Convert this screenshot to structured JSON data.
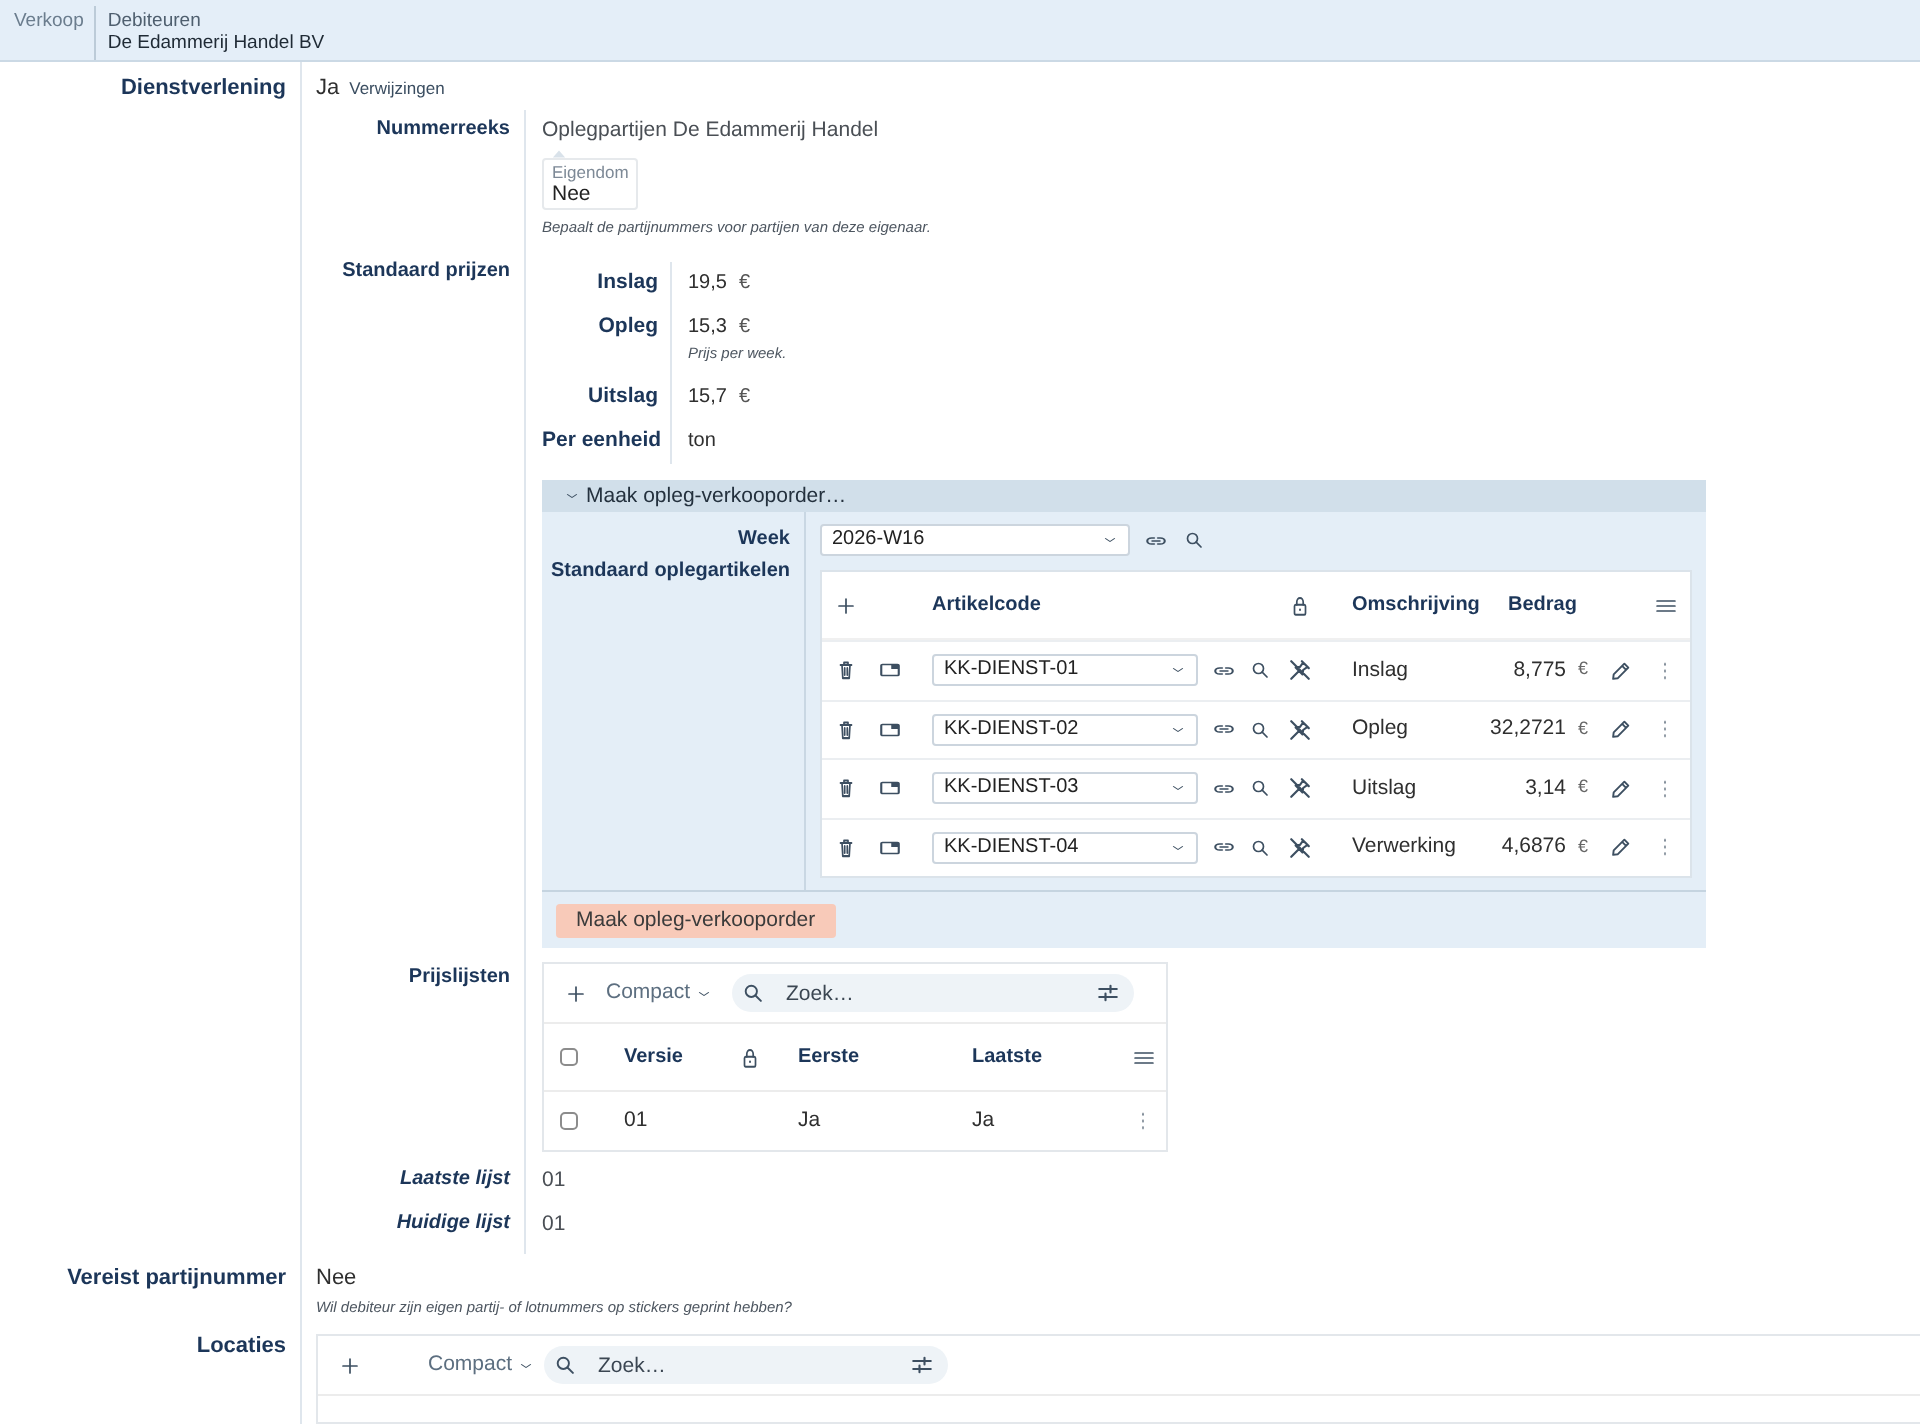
{
  "breadcrumb": {
    "section": "Verkoop",
    "parent": "Debiteuren",
    "current": "De Edammerij Handel BV"
  },
  "dienstverlening": {
    "label": "Dienstverlening",
    "value": "Ja",
    "link": "Verwijzingen",
    "nummerreeks": {
      "label": "Nummerreeks",
      "value": "Oplegpartijen De Edammerij Handel",
      "owner_field": {
        "label": "Eigendom",
        "value": "Nee"
      },
      "hint": "Bepaalt de partijnummers voor partijen van deze eigenaar."
    },
    "standaard_prijzen": {
      "label": "Standaard prijzen",
      "rows": [
        {
          "label": "Inslag",
          "value": "19,5",
          "unit": "€"
        },
        {
          "label": "Opleg",
          "value": "15,3",
          "unit": "€",
          "hint": "Prijs per week."
        },
        {
          "label": "Uitslag",
          "value": "15,7",
          "unit": "€"
        },
        {
          "label": "Per eenheid",
          "value": "ton"
        }
      ]
    },
    "order_panel": {
      "title": "Maak opleg-verkooporder…",
      "expanded": true,
      "week": {
        "label": "Week",
        "value": "2026-W16"
      },
      "articles": {
        "label": "Standaard oplegartikelen",
        "columns": [
          "Artikelcode",
          "Omschrijving",
          "Bedrag"
        ],
        "rows": [
          {
            "code": "KK-DIENST-01",
            "description": "Inslag",
            "amount": "8,775",
            "currency": "€"
          },
          {
            "code": "KK-DIENST-02",
            "description": "Opleg",
            "amount": "32,2721",
            "currency": "€"
          },
          {
            "code": "KK-DIENST-03",
            "description": "Uitslag",
            "amount": "3,14",
            "currency": "€"
          },
          {
            "code": "KK-DIENST-04",
            "description": "Verwerking",
            "amount": "4,6876",
            "currency": "€"
          }
        ]
      },
      "button": "Maak opleg-verkooporder"
    },
    "prijslijsten": {
      "label": "Prijslijsten",
      "view": "Compact",
      "search": {
        "placeholder": "Zoek…"
      },
      "all_checked": false,
      "columns": [
        "Versie",
        "Eerste",
        "Laatste"
      ],
      "rows": [
        {
          "checked": false,
          "cells": [
            "01",
            "Ja",
            "Ja"
          ]
        }
      ]
    },
    "summary": [
      {
        "label": "Laatste lijst",
        "value": "01"
      },
      {
        "label": "Huidige lijst",
        "value": "01"
      }
    ]
  },
  "vereist_partijnummer": {
    "label": "Vereist partijnummer",
    "value": "Nee",
    "hint": "Wil debiteur zijn eigen partij- of lotnummers op stickers geprint hebben?"
  },
  "locaties": {
    "label": "Locaties",
    "view": "Compact",
    "search": {
      "placeholder": "Zoek…"
    }
  }
}
